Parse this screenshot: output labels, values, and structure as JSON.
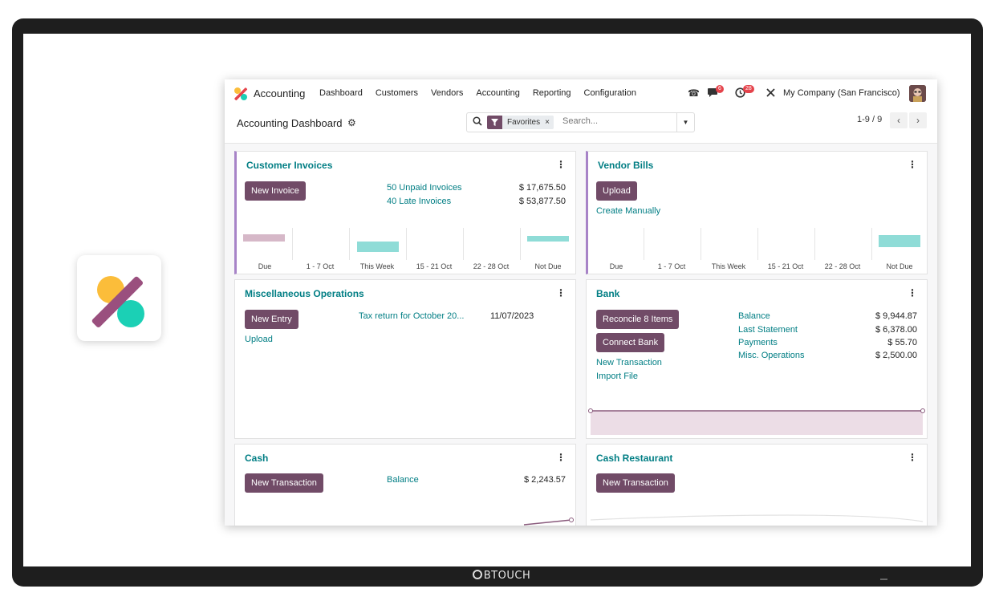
{
  "brand": {
    "label": "BTOUCH"
  },
  "app": {
    "name": "Accounting",
    "menu": [
      "Dashboard",
      "Customers",
      "Vendors",
      "Accounting",
      "Reporting",
      "Configuration"
    ],
    "messages_count": "6",
    "activities_count": "28",
    "company": "My Company (San Francisco)"
  },
  "control": {
    "title": "Accounting Dashboard",
    "facet_label": "Favorites",
    "search_placeholder": "Search...",
    "pager": "1-9 / 9"
  },
  "colors": {
    "accent": "#714b67",
    "link": "#017e84",
    "teal_bar": "#8fdcd7",
    "pink_bar": "#d6b8c8",
    "bank_area": "#ecdde6"
  },
  "customer_invoices": {
    "title": "Customer Invoices",
    "button": "New Invoice",
    "rows": [
      {
        "label": "50 Unpaid Invoices",
        "value": "$ 17,675.50"
      },
      {
        "label": "40 Late Invoices",
        "value": "$ 53,877.50"
      }
    ],
    "graph_labels": [
      "Due",
      "1 - 7 Oct",
      "This Week",
      "15 - 21 Oct",
      "22 - 28 Oct",
      "Not Due"
    ]
  },
  "vendor_bills": {
    "title": "Vendor Bills",
    "button": "Upload",
    "link": "Create Manually",
    "graph_labels": [
      "Due",
      "1 - 7 Oct",
      "This Week",
      "15 - 21 Oct",
      "22 - 28 Oct",
      "Not Due"
    ]
  },
  "misc": {
    "title": "Miscellaneous Operations",
    "button": "New Entry",
    "link": "Upload",
    "entry_label": "Tax return for October 20...",
    "entry_date": "11/07/2023"
  },
  "bank": {
    "title": "Bank",
    "button_reconcile": "Reconcile 8 Items",
    "button_connect": "Connect Bank",
    "link_new": "New Transaction",
    "link_import": "Import File",
    "rows": [
      {
        "label": "Balance",
        "value": "$ 9,944.87"
      },
      {
        "label": "Last Statement",
        "value": "$ 6,378.00"
      },
      {
        "label": "Payments",
        "value": "$ 55.70"
      },
      {
        "label": "Misc. Operations",
        "value": "$ 2,500.00"
      }
    ]
  },
  "cash": {
    "title": "Cash",
    "button": "New Transaction",
    "balance_label": "Balance",
    "balance_value": "$ 2,243.57"
  },
  "cash_restaurant": {
    "title": "Cash Restaurant",
    "button": "New Transaction"
  }
}
